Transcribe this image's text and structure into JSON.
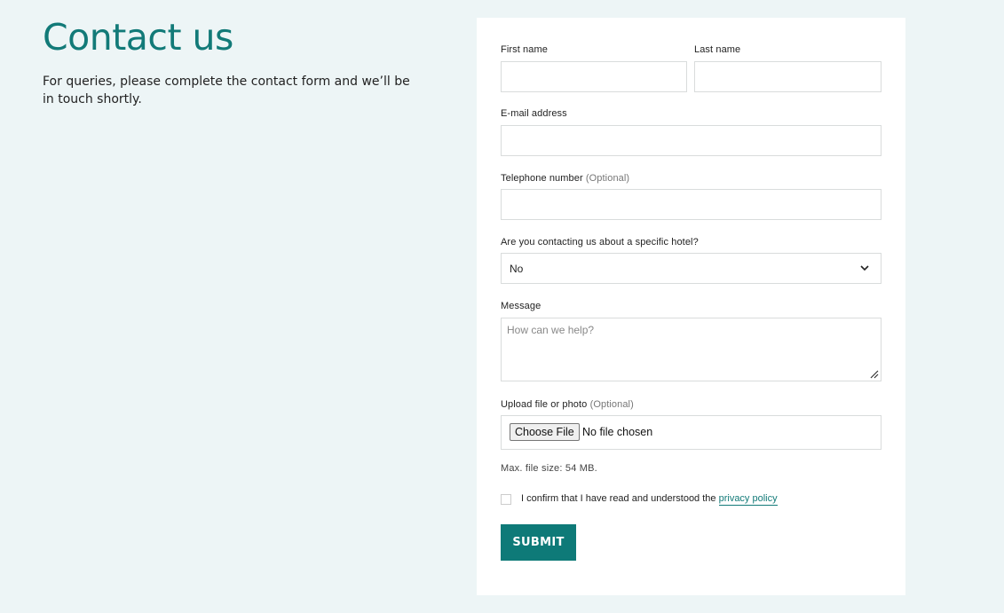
{
  "page": {
    "title": "Contact us",
    "intro": "For queries, please complete the contact form and we’ll be in touch shortly."
  },
  "form": {
    "first_name": {
      "label": "First name",
      "value": ""
    },
    "last_name": {
      "label": "Last name",
      "value": ""
    },
    "email": {
      "label": "E-mail address",
      "value": ""
    },
    "telephone": {
      "label": "Telephone number",
      "optional": "(Optional)",
      "value": ""
    },
    "hotel": {
      "label": "Are you contacting us about a specific hotel?",
      "selected": "No"
    },
    "message": {
      "label": "Message",
      "placeholder": "How can we help?",
      "value": ""
    },
    "upload": {
      "label": "Upload file or photo",
      "optional": "(Optional)",
      "button": "Choose File",
      "status": "No file chosen",
      "hint": "Max. file size: 54 MB."
    },
    "consent": {
      "text": "I confirm that I have read and understood the ",
      "link": "privacy policy",
      "checked": false
    },
    "submit": "SUBMIT"
  },
  "colors": {
    "accent": "#0e7a78",
    "background": "#edf5f6"
  }
}
